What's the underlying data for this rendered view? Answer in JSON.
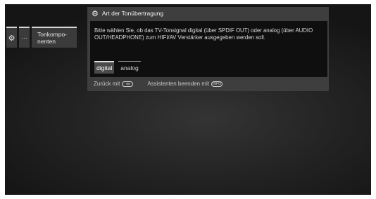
{
  "breadcrumb": {
    "gear_icon": "gear-icon",
    "dots": "···",
    "item_label": "Tonkompo-\nnenten"
  },
  "dialog": {
    "title_icon": "gears-icon",
    "title": "Art der Tonübertragung",
    "message": "Bitte wählen Sie, ob das TV-Tonsignal digital (über SPDIF OUT) oder analog (über AUDIO OUT/HEADPHONE) zum HIFI/AV Verstärker ausgegeben werden soll.",
    "options": [
      {
        "label": "digital",
        "selected": true
      },
      {
        "label": "analog",
        "selected": false
      }
    ],
    "footer": {
      "back_label": "Zurück mit",
      "back_key": "◂◂",
      "exit_label": "Assistenten beenden mit",
      "exit_key": "INFO"
    }
  }
}
